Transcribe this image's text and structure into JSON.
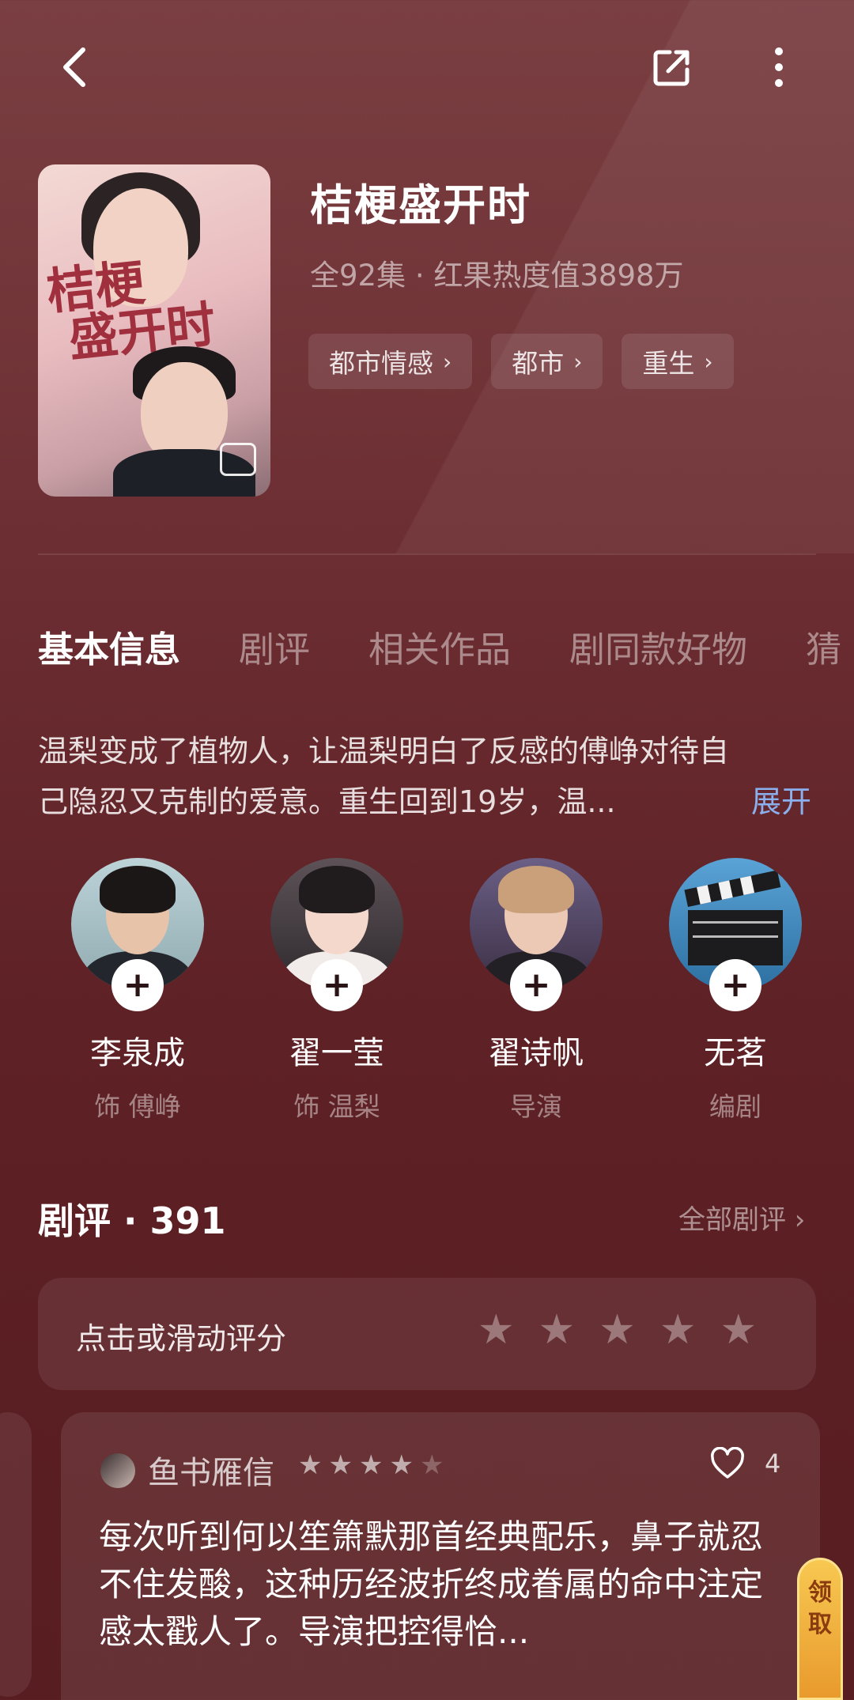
{
  "drama": {
    "title": "桔梗盛开时",
    "subtitle": "全92集 · 红果热度值3898万",
    "tags": [
      "都市情感",
      "都市",
      "重生"
    ]
  },
  "tabs": [
    "基本信息",
    "剧评",
    "相关作品",
    "剧同款好物",
    "猜"
  ],
  "description": {
    "line1": "温梨变成了植物人，让温梨明白了反感的傅峥对待自",
    "line2": "己隐忍又克制的爱意。重生回到19岁，温...",
    "expand_label": "展开"
  },
  "cast": [
    {
      "name": "李泉成",
      "role": "饰 傅峥"
    },
    {
      "name": "翟一莹",
      "role": "饰 温梨"
    },
    {
      "name": "翟诗帆",
      "role": "导演"
    },
    {
      "name": "无茗",
      "role": "编剧"
    }
  ],
  "reviews": {
    "header": "剧评 · 391",
    "all_label": "全部剧评 ›",
    "rate_prompt": "点击或滑动评分",
    "item": {
      "user": "鱼书雁信",
      "stars": 4.5,
      "likes": "4",
      "text": "每次听到何以笙箫默那首经典配乐，鼻子就忍不住发酸，这种历经波折终成眷属的命中注定感太戳人了。导演把控得恰..."
    }
  },
  "reward": {
    "line1": "领",
    "line2": "取"
  },
  "colors": {
    "background": "#6d2f33",
    "link": "#8ab0ee"
  },
  "icons": [
    "back-icon",
    "share-icon",
    "more-icon",
    "gallery-icon",
    "heart-icon",
    "star-icon",
    "plus-icon"
  ]
}
